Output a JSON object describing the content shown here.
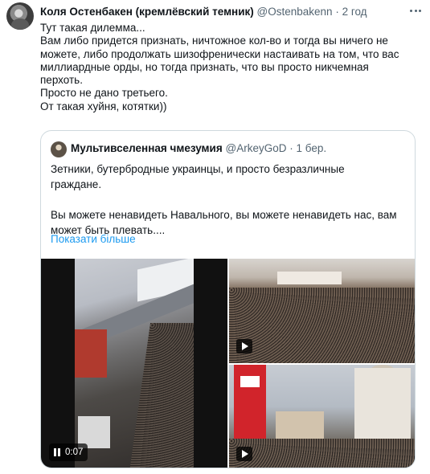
{
  "tweet": {
    "author_name": "Коля Остенбакен (кремлёвский темник)",
    "author_handle": "@Ostenbakenn",
    "separator": "·",
    "time": "2 год",
    "lines": [
      "Тут такая дилемма...",
      "Вам либо придется признать, ничтожное кол-во и тогда вы ничего не",
      "можете, либо продолжать шизофренически настаивать на том, что вас",
      "миллиардные орды, но тогда признать, что вы просто никчемная",
      "перхоть.",
      "Просто не дано третьего.",
      "От такая хуйня, котятки))"
    ]
  },
  "quote": {
    "author_name": "Мультивселенная чмезумия",
    "author_handle": "@ArkeyGoD",
    "separator": "·",
    "time": "1 бер.",
    "lines_para1": [
      "Зетники, бутербродные украинцы, и просто безразличные",
      "граждане."
    ],
    "lines_para2": [
      "Вы можете ненавидеть Навального, вы можете ненавидеть нас, вам",
      "может быть плевать...."
    ],
    "show_more": "Показати більше",
    "video_time": "0:07"
  },
  "colors": {
    "text": "#0f1419",
    "secondary": "#536471",
    "link": "#1d9bf0",
    "border": "#cfd9de"
  },
  "icons": [
    "more-icon",
    "pause-icon",
    "video-play-icon"
  ]
}
